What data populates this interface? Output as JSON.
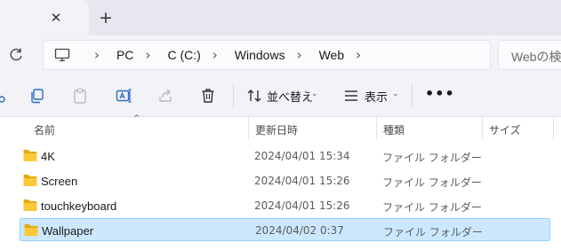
{
  "tab": {
    "close_glyph": "✕",
    "new_tab_glyph": "+"
  },
  "address": {
    "crumbs": [
      "PC",
      "C (C:)",
      "Windows",
      "Web"
    ],
    "separator": "›",
    "search_placeholder": "Webの検索"
  },
  "toolbar": {
    "sort_label": "並べ替え",
    "view_label": "表示",
    "more_label": "•••",
    "chevron": "⌄"
  },
  "columns": {
    "name": "名前",
    "modified": "更新日時",
    "type": "種類",
    "size": "サイズ",
    "sort_indicator": "^"
  },
  "rows": [
    {
      "name": "4K",
      "modified": "2024/04/01 15:34",
      "type": "ファイル フォルダー",
      "size": "",
      "selected": false
    },
    {
      "name": "Screen",
      "modified": "2024/04/01 15:26",
      "type": "ファイル フォルダー",
      "size": "",
      "selected": false
    },
    {
      "name": "touchkeyboard",
      "modified": "2024/04/01 15:26",
      "type": "ファイル フォルダー",
      "size": "",
      "selected": false
    },
    {
      "name": "Wallpaper",
      "modified": "2024/04/02 0:37",
      "type": "ファイル フォルダー",
      "size": "",
      "selected": true
    }
  ],
  "colors": {
    "accent": "#005fb8",
    "selection": "#cce8ff",
    "folder": "#f8c435"
  }
}
